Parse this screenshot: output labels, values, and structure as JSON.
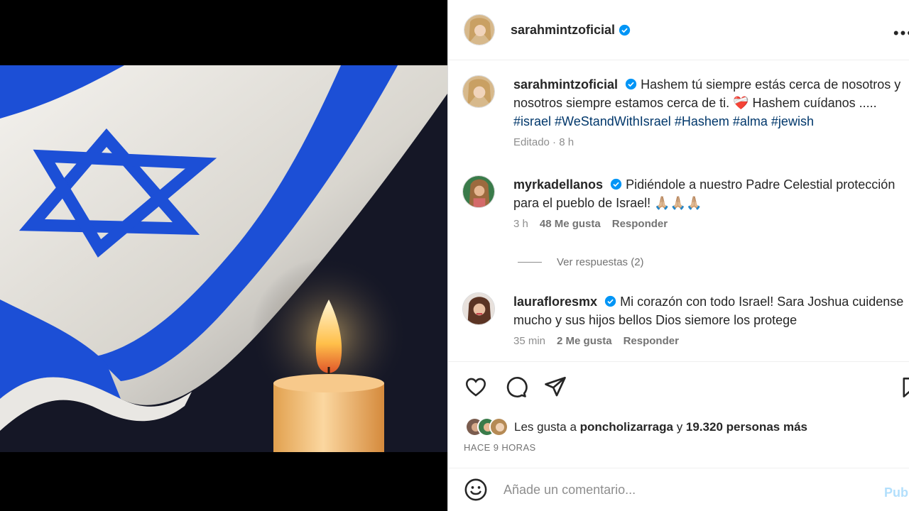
{
  "post": {
    "author": "sarahmintzoficial",
    "caption_author": "sarahmintzoficial",
    "caption_text": "Hashem tú siempre estás cerca de nosotros y nosotros siempre estamos cerca de ti. ❤️‍🩹 Hashem cuídanos .....",
    "hashtags": [
      "#israel",
      "#WeStandWithIsrael",
      "#Hashem",
      "#alma",
      "#jewish"
    ],
    "caption_meta": "Editado · 8 h"
  },
  "comments": [
    {
      "username": "myrkadellanos",
      "text": "Pidiéndole a nuestro Padre Celestial protección para el pueblo de Israel! 🙏🏼🙏🏼🙏🏼",
      "time": "3 h",
      "likes": "48 Me gusta",
      "reply": "Responder"
    },
    {
      "username": "laurafloresmx",
      "text": "Mi corazón con todo Israel! Sara Joshua cuidense mucho y sus hijos bellos Dios siemore los protege",
      "time": "35 min",
      "likes": "2 Me gusta",
      "reply": "Responder"
    }
  ],
  "view_replies": "Ver respuestas (2)",
  "likes_summary": {
    "prefix": "Les gusta a",
    "user": "poncholizarraga",
    "connector": "y",
    "count": "19.320 personas más"
  },
  "posted_ago": "HACE 9 HORAS",
  "comment_box": {
    "placeholder": "Añade un comentario...",
    "publish": "Publi"
  },
  "icons": {
    "more": "more-options-icon",
    "like": "heart-icon",
    "comment": "comment-bubble-icon",
    "share": "paper-plane-icon",
    "save": "bookmark-icon",
    "emoji": "emoji-smile-icon",
    "verified": "verified-badge-icon"
  },
  "colors": {
    "verified": "#0095f6",
    "hashtag": "#00376b",
    "flag_blue": "#1c4fd6",
    "publish": "#b2dffc"
  }
}
